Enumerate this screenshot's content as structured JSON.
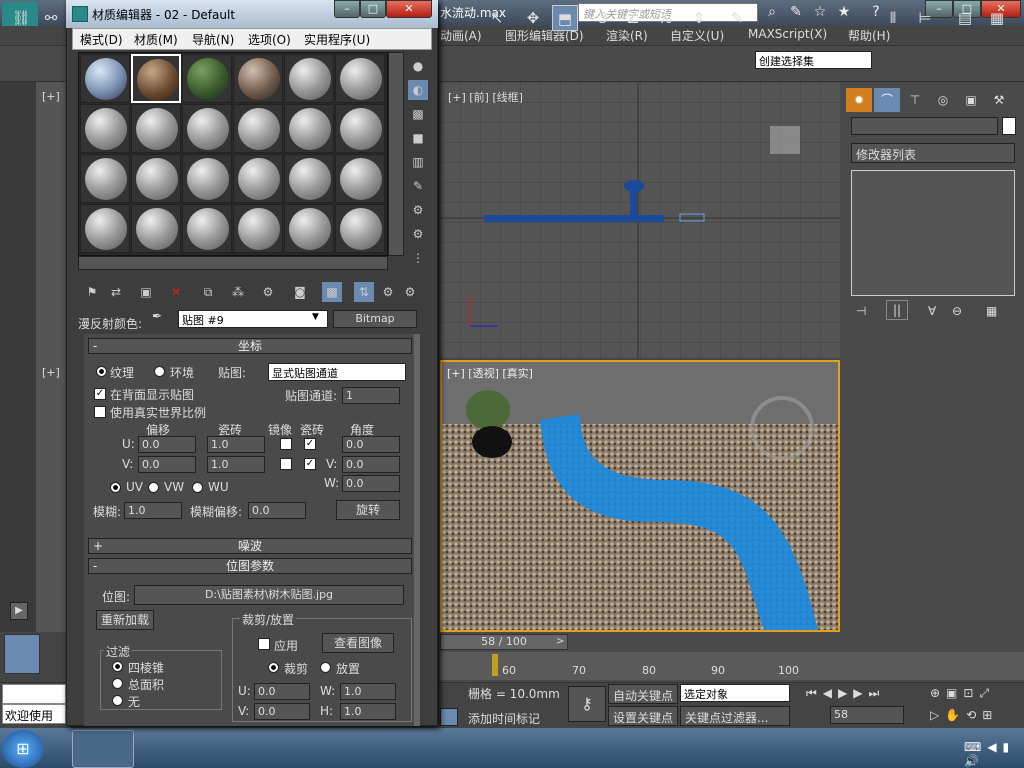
{
  "app": {
    "title": "水流动.max",
    "search_placeholder": "键入关键字或短语"
  },
  "menu": [
    "动画(A)",
    "图形编辑器(D)",
    "渲染(R)",
    "自定义(U)",
    "MAXScript(X)",
    "帮助(H)"
  ],
  "toolbar": {
    "selection_set": "创建选择集",
    "snap_3": "3",
    "snap_pct": "%"
  },
  "viewports": {
    "top_label": "[+] [前] [线框]",
    "persp_label": "[+] [透视] [真实]"
  },
  "command_panel": {
    "modifier_list": "修改器列表"
  },
  "timeline": {
    "slider": "58 / 100",
    "ticks": [
      "60",
      "70",
      "80",
      "90",
      "100"
    ]
  },
  "status": {
    "grid": "栅格 = 10.0mm",
    "auto_key": "自动关键点",
    "selected": "选定对象",
    "set_key": "设置关键点",
    "key_filter": "关键点过滤器...",
    "frame": "58",
    "add_time_tag": "添加时间标记",
    "welcome": "欢迎使用"
  },
  "material_editor": {
    "title": "材质编辑器 - 02 - Default",
    "menu": [
      "模式(D)",
      "材质(M)",
      "导航(N)",
      "选项(O)",
      "实用程序(U)"
    ],
    "diffuse_label": "漫反射颜色:",
    "map_name": "贴图 #9",
    "map_type": "Bitmap",
    "coords": {
      "header": "坐标",
      "texture": "纹理",
      "environ": "环境",
      "map_label": "贴图:",
      "map_channel_mode": "显式贴图通道",
      "show_back": "在背面显示贴图",
      "map_channel_label": "贴图通道:",
      "map_channel": "1",
      "real_world": "使用真实世界比例",
      "offset": "偏移",
      "tiling": "瓷砖",
      "mirror": "镜像",
      "tile": "瓷砖",
      "angle": "角度",
      "u": "U:",
      "v": "V:",
      "w": "W:",
      "u_offset": "0.0",
      "v_offset": "0.0",
      "u_tiling": "1.0",
      "v_tiling": "1.0",
      "u_angle": "0.0",
      "v_angle": "0.0",
      "w_angle": "0.0",
      "uv": "UV",
      "vw": "VW",
      "wu": "WU",
      "blur": "模糊:",
      "blur_val": "1.0",
      "blur_offset": "模糊偏移:",
      "blur_offset_val": "0.0",
      "rotate": "旋转"
    },
    "noise": {
      "header": "噪波"
    },
    "bitmap": {
      "header": "位图参数",
      "bitmap_label": "位图:",
      "path": "D:\\贴图素材\\树木贴图.jpg",
      "reload": "重新加载",
      "crop": "裁剪/放置",
      "apply": "应用",
      "view_image": "查看图像",
      "crop_opt": "裁剪",
      "place_opt": "放置",
      "filter": "过滤",
      "pyramid": "四棱锥",
      "summed": "总面积",
      "none": "无",
      "u": "U:",
      "v": "V:",
      "w": "W:",
      "h": "H:",
      "u_val": "0.0",
      "v_val": "0.0",
      "w_val": "1.0",
      "h_val": "1.0"
    }
  }
}
